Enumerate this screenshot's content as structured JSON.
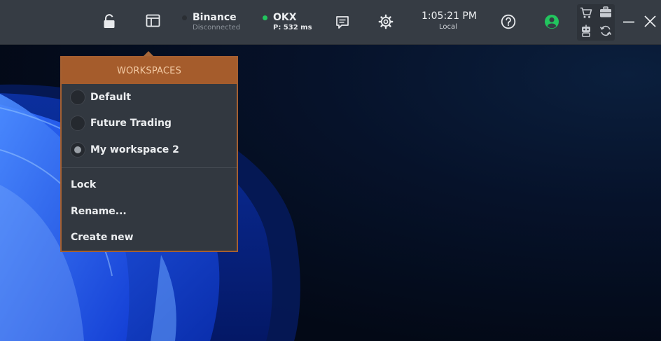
{
  "toolbar": {
    "lock_icon": "lock-icon",
    "workspaces_icon": "workspace-icon",
    "exchanges": [
      {
        "name": "Binance",
        "status": "Disconnected",
        "dot_color": "#2a2e33"
      },
      {
        "name": "OKX",
        "status": "P: 532 ms",
        "dot_color": "#22c55e"
      }
    ],
    "clock": {
      "time": "1:05:21 PM",
      "zone": "Local"
    },
    "icons": [
      "chat-icon",
      "gear-icon",
      "help-icon",
      "user-icon",
      "cart-icon",
      "briefcase-icon",
      "robot-icon",
      "refresh-icon",
      "minimize-icon",
      "close-icon"
    ]
  },
  "workspaces_menu": {
    "title": "WORKSPACES",
    "items": [
      {
        "label": "Default",
        "selected": false
      },
      {
        "label": "Future Trading",
        "selected": false
      },
      {
        "label": "My workspace 2",
        "selected": true
      }
    ],
    "actions": [
      {
        "label": "Lock"
      },
      {
        "label": "Rename..."
      },
      {
        "label": "Create new"
      }
    ]
  },
  "colors": {
    "toolbar_bg": "#363c44",
    "menu_header_bg": "#a55c2c",
    "menu_header_text": "#f2c9a3",
    "menu_bg": "#323840",
    "connected": "#22c55e",
    "user_icon": "#22c55e"
  }
}
